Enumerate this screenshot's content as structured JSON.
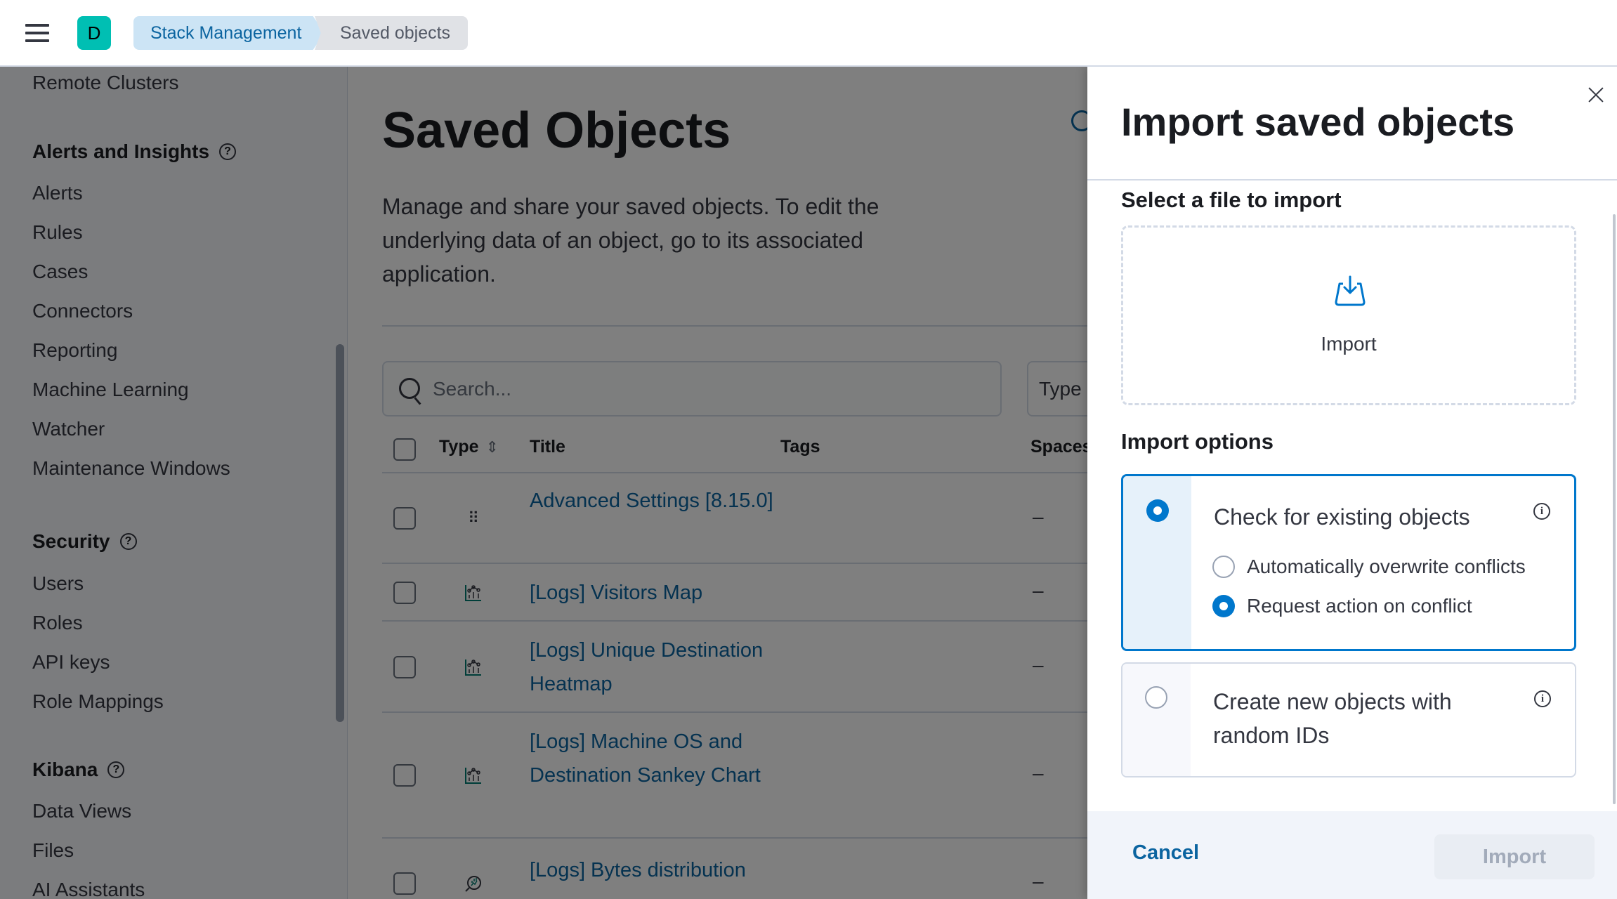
{
  "header": {
    "space_initial": "D",
    "breadcrumbs": [
      "Stack Management",
      "Saved objects"
    ]
  },
  "sidebar": {
    "top_item": "Remote Clusters",
    "groups": [
      {
        "title": "Alerts and Insights",
        "items": [
          "Alerts",
          "Rules",
          "Cases",
          "Connectors",
          "Reporting",
          "Machine Learning",
          "Watcher",
          "Maintenance Windows"
        ]
      },
      {
        "title": "Security",
        "items": [
          "Users",
          "Roles",
          "API keys",
          "Role Mappings"
        ]
      },
      {
        "title": "Kibana",
        "items": [
          "Data Views",
          "Files",
          "AI Assistants"
        ]
      }
    ]
  },
  "main": {
    "title": "Saved Objects",
    "description": "Manage and share your saved objects. To edit the underlying data of an object, go to its associated application.",
    "search_placeholder": "Search...",
    "type_filter_label": "Type",
    "columns": {
      "type": "Type",
      "title": "Title",
      "tags": "Tags",
      "spaces": "Spaces"
    },
    "rows": [
      {
        "type_icon": "advanced-settings-icon",
        "title": "Advanced Settings [8.15.0]",
        "spaces": "–"
      },
      {
        "type_icon": "visualization-icon",
        "title": "[Logs] Visitors Map",
        "spaces": "–"
      },
      {
        "type_icon": "visualization-icon",
        "title": "[Logs] Unique Destination Heatmap",
        "spaces": "–"
      },
      {
        "type_icon": "visualization-icon",
        "title": "[Logs] Machine OS and Destination Sankey Chart",
        "spaces": "–"
      },
      {
        "type_icon": "lens-icon",
        "title": "[Logs] Bytes distribution",
        "spaces": "–"
      }
    ]
  },
  "flyout": {
    "title": "Import saved objects",
    "select_file_title": "Select a file to import",
    "dropzone_label": "Import",
    "import_options_title": "Import options",
    "options": [
      {
        "label": "Check for existing objects",
        "selected": true,
        "sub_options": [
          {
            "label": "Automatically overwrite conflicts",
            "selected": false
          },
          {
            "label": "Request action on conflict",
            "selected": true
          }
        ]
      },
      {
        "label": "Create new objects with random IDs",
        "selected": false
      }
    ],
    "cancel_label": "Cancel",
    "import_label": "Import"
  },
  "colors": {
    "primary": "#0077cc",
    "link": "#0b64a0",
    "space_avatar": "#00bfb3"
  }
}
